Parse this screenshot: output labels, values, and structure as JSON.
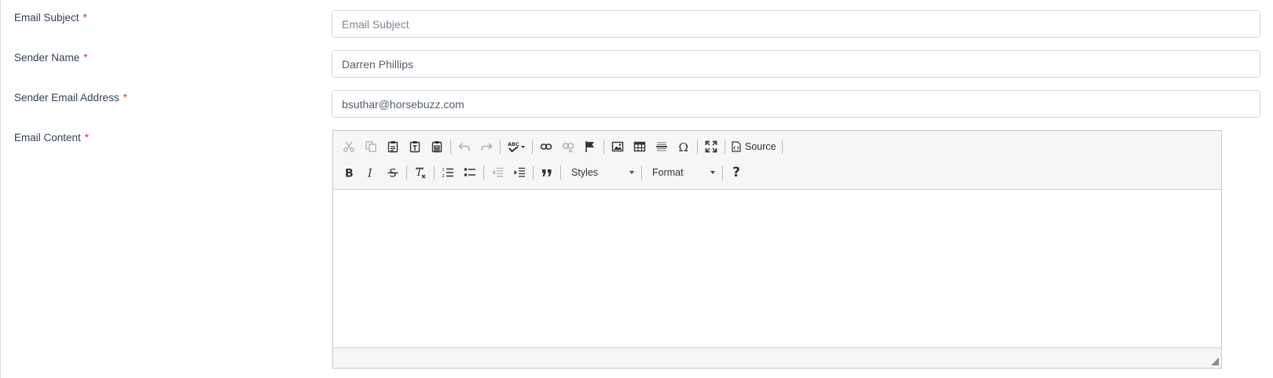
{
  "form": {
    "email_subject": {
      "label": "Email Subject",
      "required_mark": "*",
      "value": "",
      "placeholder": "Email Subject"
    },
    "sender_name": {
      "label": "Sender Name",
      "required_mark": "*",
      "value": "Darren Phillips"
    },
    "sender_email": {
      "label": "Sender Email Address",
      "required_mark": "*",
      "value": "bsuthar@horsebuzz.com"
    },
    "email_content": {
      "label": "Email Content",
      "required_mark": "*"
    }
  },
  "editor": {
    "toolbar_row1": [
      "cut-icon",
      "copy-icon",
      "paste-icon",
      "paste-text-icon",
      "paste-word-icon",
      "undo-icon",
      "redo-icon",
      "spellcheck-icon",
      "link-icon",
      "unlink-icon",
      "anchor-icon",
      "image-icon",
      "table-icon",
      "horizontal-rule-icon",
      "special-char-icon",
      "maximize-icon",
      "source-icon"
    ],
    "source_label": "Source",
    "toolbar_row2": [
      "bold-icon",
      "italic-icon",
      "strike-icon",
      "remove-format-icon",
      "numbered-list-icon",
      "bulleted-list-icon",
      "outdent-icon",
      "indent-icon",
      "blockquote-icon",
      "help-icon"
    ],
    "styles_label": "Styles",
    "format_label": "Format",
    "help_label": "?"
  },
  "colors": {
    "required": "#e0313b",
    "label_text": "#344054",
    "toolbar_bg": "#f6f6f6"
  }
}
